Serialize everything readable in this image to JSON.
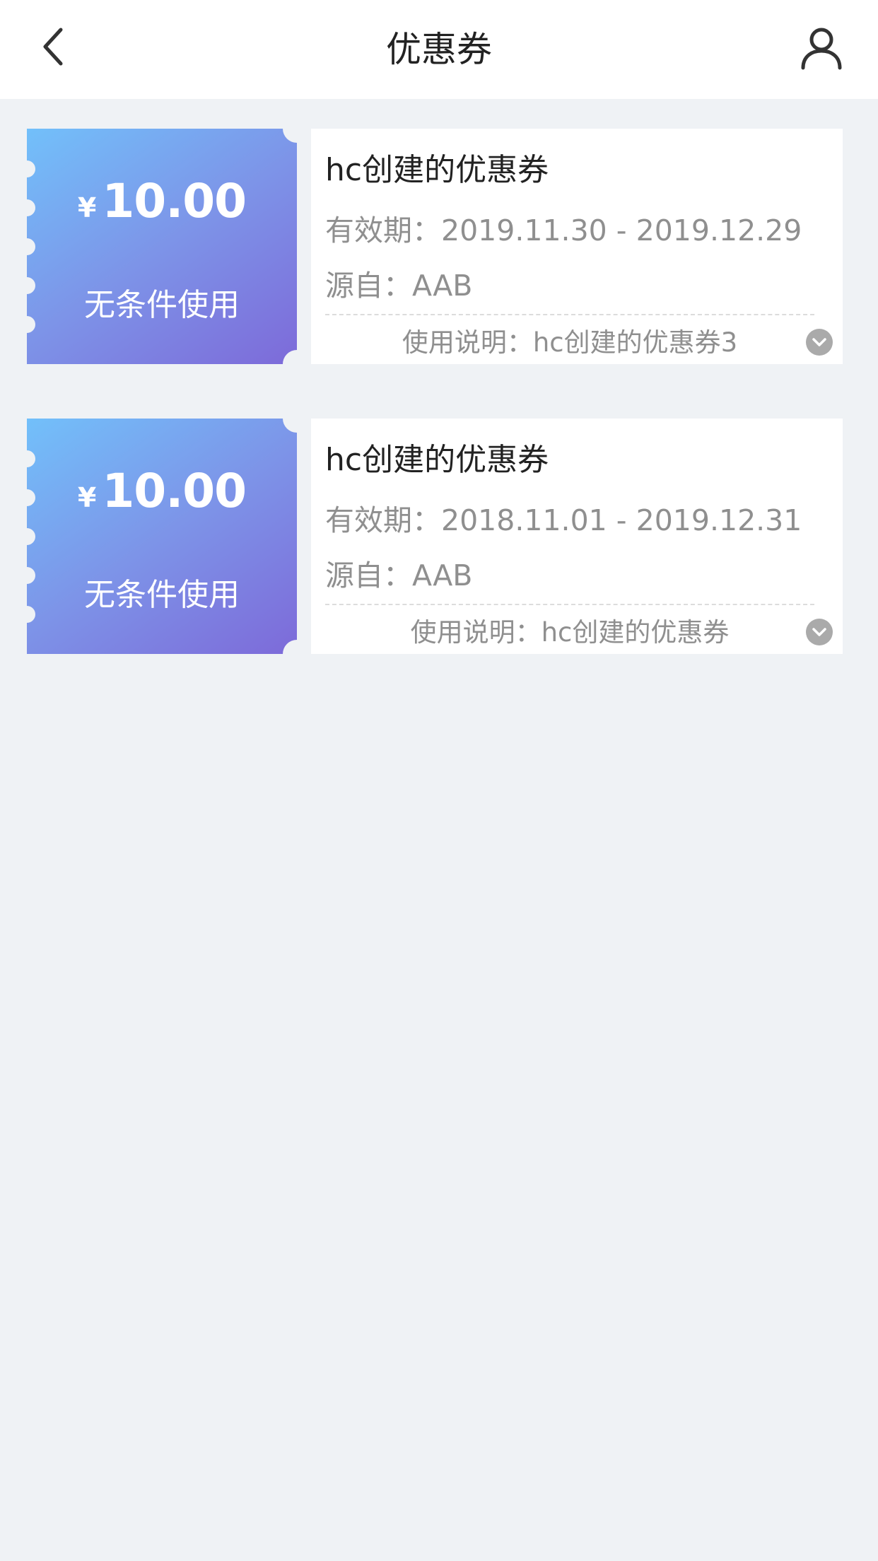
{
  "header": {
    "title": "优惠券",
    "back_icon": "chevron-left-icon",
    "user_icon": "user-icon"
  },
  "coupons": [
    {
      "currency": "¥",
      "amount": "10.00",
      "condition": "无条件使用",
      "title": "hc创建的优惠券",
      "validity": "有效期：2019.11.30 - 2019.12.29",
      "source": "源自：AAB",
      "description": "使用说明：hc创建的优惠券3"
    },
    {
      "currency": "¥",
      "amount": "10.00",
      "condition": "无条件使用",
      "title": "hc创建的优惠券",
      "validity": "有效期：2018.11.01 - 2019.12.31",
      "source": "源自：AAB",
      "description": "使用说明：hc创建的优惠券"
    }
  ],
  "colors": {
    "background": "#eff2f5",
    "gradient_start": "#72c0fa",
    "gradient_end": "#7d6ad9",
    "muted_text": "#8f8f8f",
    "title_text": "#222222"
  }
}
